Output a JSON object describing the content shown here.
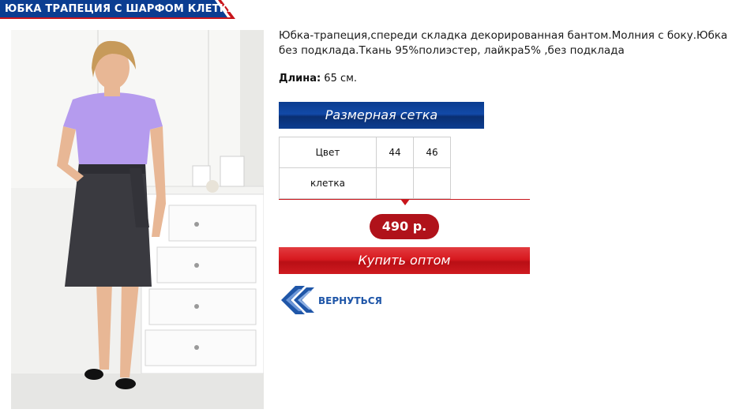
{
  "title": "ЮБКА ТРАПЕЦИЯ С ШАРФОМ КЛЕТКА",
  "product": {
    "description": " Юбка-трапеция,спереди складка декорированная бантом.Молния с боку.Юбка без подклада.Ткань  95%полиэстер, лайкра5%   ,без подклада",
    "length_label": "Длина:",
    "length_value": " 65 см.",
    "image_icon": "woman-in-skirt-photo"
  },
  "size_grid_button": "Размерная сетка",
  "size_table": {
    "header": [
      "Цвет",
      "44",
      "46"
    ],
    "rows": [
      [
        "клетка",
        "",
        ""
      ]
    ]
  },
  "price": "490 р.",
  "buy_button": "Купить оптом",
  "back_link": "ВЕРНУТЬСЯ",
  "colors": {
    "title_blue": "#0b3d91",
    "accent_red": "#c8151b",
    "link_blue": "#1f56a8"
  }
}
